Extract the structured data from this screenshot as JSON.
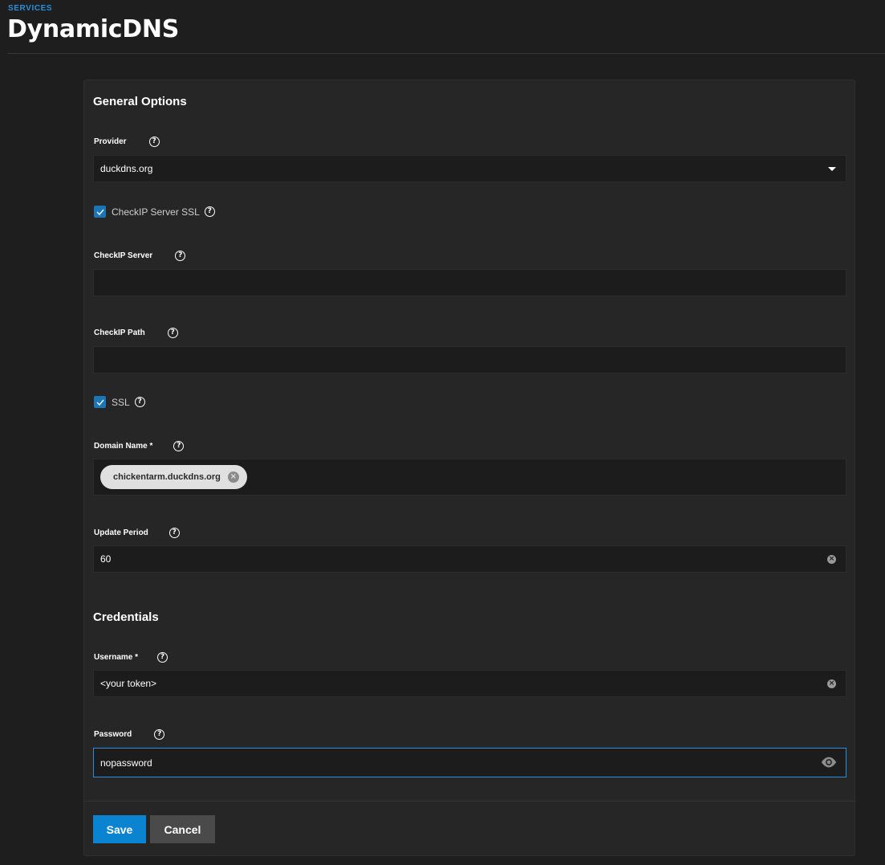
{
  "header": {
    "breadcrumb": "SERVICES",
    "title": "DynamicDNS"
  },
  "general": {
    "section_title": "General Options",
    "provider": {
      "label": "Provider",
      "value": "duckdns.org"
    },
    "checkip_server_ssl": {
      "label": "CheckIP Server SSL",
      "checked": true
    },
    "checkip_server": {
      "label": "CheckIP Server",
      "value": ""
    },
    "checkip_path": {
      "label": "CheckIP Path",
      "value": ""
    },
    "ssl": {
      "label": "SSL",
      "checked": true
    },
    "domain_name": {
      "label": "Domain Name *",
      "chips": [
        "chickentarm.duckdns.org"
      ]
    },
    "update_period": {
      "label": "Update Period",
      "value": "60"
    }
  },
  "credentials": {
    "section_title": "Credentials",
    "username": {
      "label": "Username *",
      "value": "<your token>"
    },
    "password": {
      "label": "Password",
      "value": "nopassword"
    }
  },
  "actions": {
    "save_label": "Save",
    "cancel_label": "Cancel"
  },
  "colors": {
    "accent": "#2a8fd8",
    "save_button": "#0a84d0",
    "cancel_button": "#4a4a4a",
    "checkbox": "#1a76b6"
  },
  "icons": {
    "help": "help-circle-icon",
    "dropdown": "caret-down-icon",
    "clear": "clear-icon",
    "visibility": "eye-icon",
    "check": "checkmark-icon",
    "chip_remove": "cancel-circle-icon"
  }
}
